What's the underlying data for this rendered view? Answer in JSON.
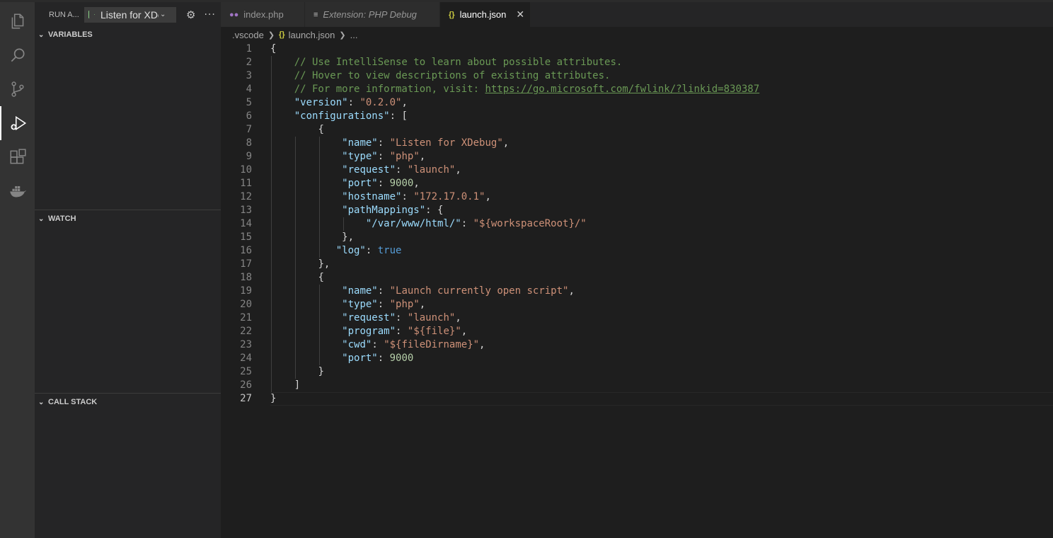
{
  "activity_bar": {
    "items": [
      {
        "icon": "files-icon",
        "active": false
      },
      {
        "icon": "search-icon",
        "active": false
      },
      {
        "icon": "source-control-icon",
        "active": false
      },
      {
        "icon": "run-debug-icon",
        "active": true
      },
      {
        "icon": "extensions-icon",
        "active": false
      },
      {
        "icon": "docker-icon",
        "active": false
      }
    ]
  },
  "sidebar": {
    "title": "RUN A...",
    "config_selected": "Listen for XDebug",
    "sections": {
      "variables": "VARIABLES",
      "watch": "WATCH",
      "call_stack": "CALL STACK"
    }
  },
  "tabs": [
    {
      "label": "index.php",
      "icon": "php-icon",
      "active": false,
      "italic": false
    },
    {
      "label": "Extension: PHP Debug",
      "icon": "preview-icon",
      "active": false,
      "italic": true
    },
    {
      "label": "launch.json",
      "icon": "json-icon",
      "active": true,
      "italic": false
    }
  ],
  "breadcrumb": {
    "folder": ".vscode",
    "file": "launch.json",
    "more": "..."
  },
  "editor": {
    "current_line": 27,
    "lines": [
      "{",
      "    // Use IntelliSense to learn about possible attributes.",
      "    // Hover to view descriptions of existing attributes.",
      "    // For more information, visit: https://go.microsoft.com/fwlink/?linkid=830387",
      "    \"version\": \"0.2.0\",",
      "    \"configurations\": [",
      "        {",
      "            \"name\": \"Listen for XDebug\",",
      "            \"type\": \"php\",",
      "            \"request\": \"launch\",",
      "            \"port\": 9000,",
      "            \"hostname\": \"172.17.0.1\",",
      "            \"pathMappings\": {",
      "                \"/var/www/html/\": \"${workspaceRoot}/\"",
      "            },",
      "           \"log\": true",
      "        },",
      "        {",
      "            \"name\": \"Launch currently open script\",",
      "            \"type\": \"php\",",
      "            \"request\": \"launch\",",
      "            \"program\": \"${file}\",",
      "            \"cwd\": \"${fileDirname}\",",
      "            \"port\": 9000",
      "        }",
      "    ]",
      "}"
    ]
  },
  "colors": {
    "comment": "#6a9955",
    "key": "#9cdcfe",
    "string": "#ce9178",
    "number": "#b5cea8",
    "boolean": "#569cd6"
  }
}
